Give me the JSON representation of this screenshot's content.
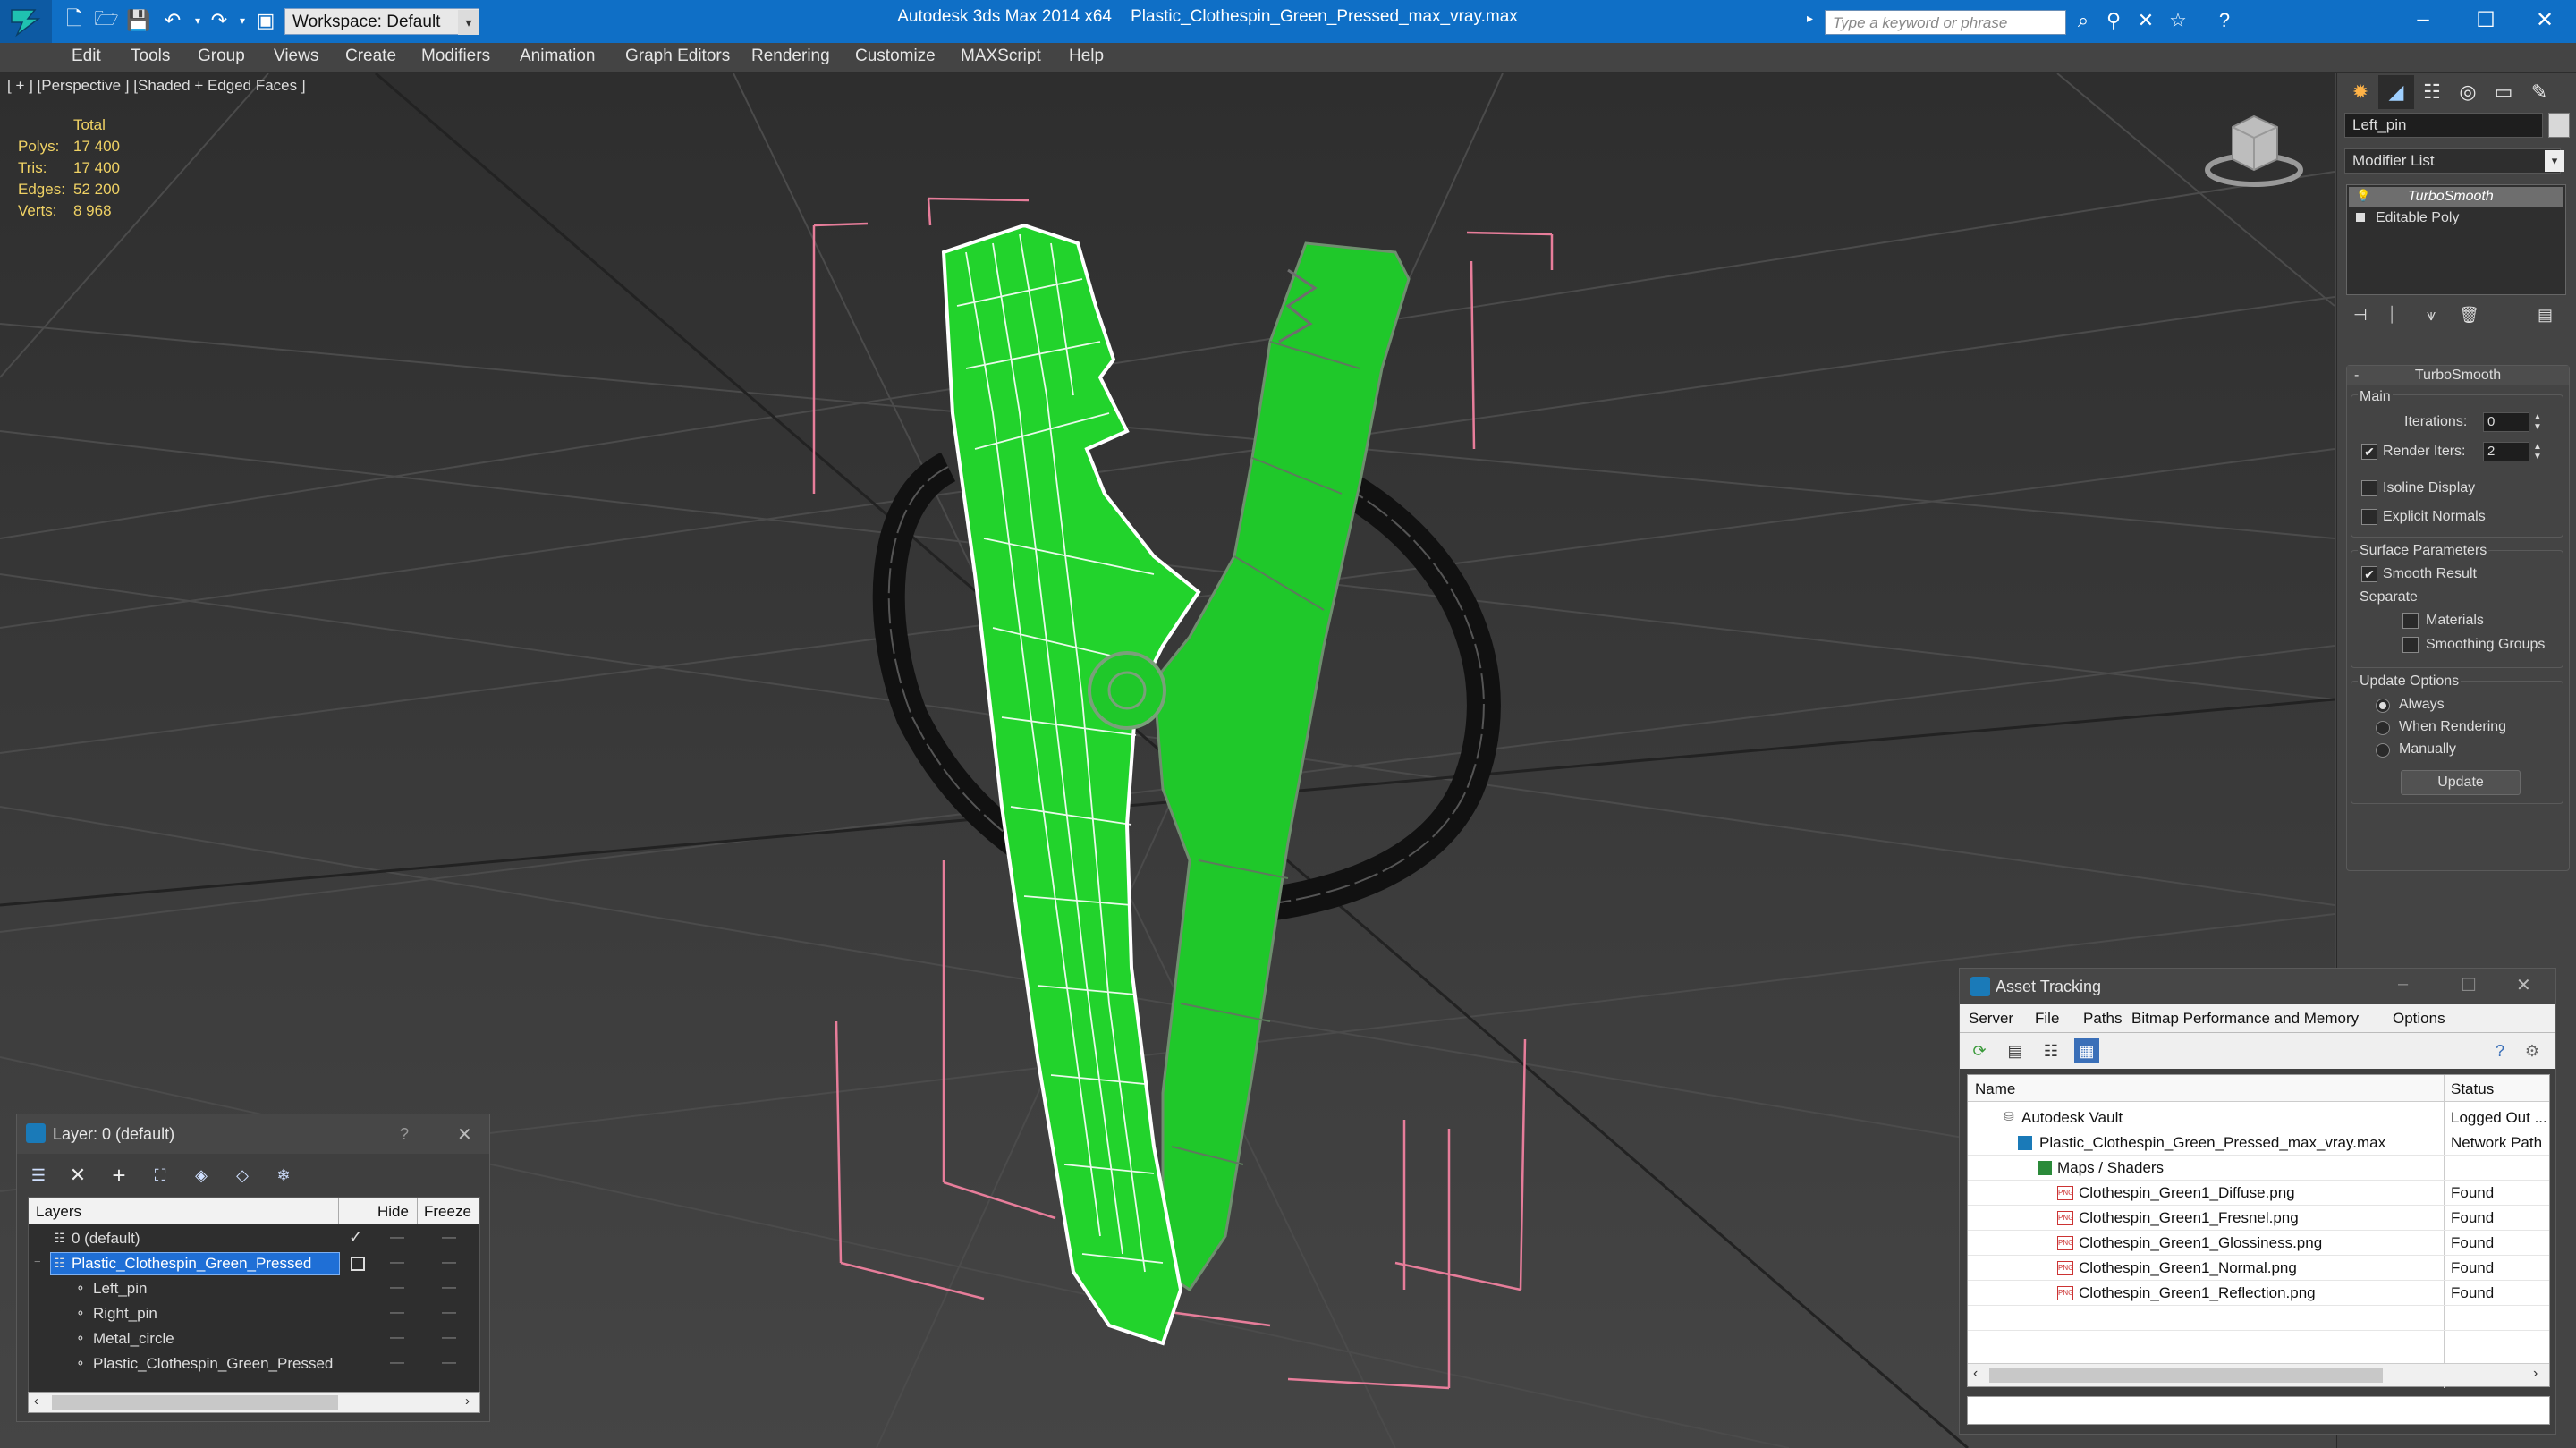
{
  "titlebar": {
    "workspace_label": "Workspace: Default",
    "app_name": "Autodesk 3ds Max  2014 x64",
    "file_name": "Plastic_Clothespin_Green_Pressed_max_vray.max",
    "search_placeholder": "Type a keyword or phrase"
  },
  "menu": [
    "Edit",
    "Tools",
    "Group",
    "Views",
    "Create",
    "Modifiers",
    "Animation",
    "Graph Editors",
    "Rendering",
    "Customize",
    "MAXScript",
    "Help"
  ],
  "viewport": {
    "label": "[ + ] [Perspective ] [Shaded + Edged Faces ]",
    "stats_header": "Total",
    "stats": [
      {
        "label": "Polys:",
        "value": "17 400"
      },
      {
        "label": "Tris:",
        "value": "17 400"
      },
      {
        "label": "Edges:",
        "value": "52 200"
      },
      {
        "label": "Verts:",
        "value": "8 968"
      }
    ]
  },
  "command_panel": {
    "object_name": "Left_pin",
    "modifier_list_label": "Modifier List",
    "stack": [
      "TurboSmooth",
      "Editable Poly"
    ],
    "rollout_title": "TurboSmooth",
    "main_group": "Main",
    "iterations_label": "Iterations:",
    "iterations_value": "0",
    "render_iters_label": "Render Iters:",
    "render_iters_value": "2",
    "isoline_label": "Isoline Display",
    "explicit_normals_label": "Explicit Normals",
    "surface_group": "Surface Parameters",
    "smooth_result_label": "Smooth Result",
    "separate_label": "Separate",
    "materials_label": "Materials",
    "smoothing_groups_label": "Smoothing Groups",
    "update_group": "Update Options",
    "always_label": "Always",
    "when_rendering_label": "When Rendering",
    "manually_label": "Manually",
    "update_button": "Update"
  },
  "layer_dialog": {
    "title": "Layer: 0 (default)",
    "help": "?",
    "col_layers": "Layers",
    "col_hide": "Hide",
    "col_freeze": "Freeze",
    "rows": [
      {
        "name": "0 (default)"
      },
      {
        "name": "Plastic_Clothespin_Green_Pressed"
      },
      {
        "name": "Left_pin"
      },
      {
        "name": "Right_pin"
      },
      {
        "name": "Metal_circle"
      },
      {
        "name": "Plastic_Clothespin_Green_Pressed"
      }
    ]
  },
  "asset_dialog": {
    "title": "Asset Tracking",
    "menu": [
      "Server",
      "File",
      "Paths",
      "Bitmap Performance and Memory",
      "Options"
    ],
    "col_name": "Name",
    "col_status": "Status",
    "rows": [
      {
        "name": "Autodesk Vault",
        "status": "Logged Out ..."
      },
      {
        "name": "Plastic_Clothespin_Green_Pressed_max_vray.max",
        "status": "Network Path"
      },
      {
        "name": "Maps / Shaders",
        "status": ""
      },
      {
        "name": "Clothespin_Green1_Diffuse.png",
        "status": "Found"
      },
      {
        "name": "Clothespin_Green1_Fresnel.png",
        "status": "Found"
      },
      {
        "name": "Clothespin_Green1_Glossiness.png",
        "status": "Found"
      },
      {
        "name": "Clothespin_Green1_Normal.png",
        "status": "Found"
      },
      {
        "name": "Clothespin_Green1_Reflection.png",
        "status": "Found"
      }
    ]
  },
  "colors": {
    "titlebar": "#0f6fc6",
    "selection": "#1f6fd6",
    "stats": "#f0d264",
    "model": "#1fc82a"
  }
}
